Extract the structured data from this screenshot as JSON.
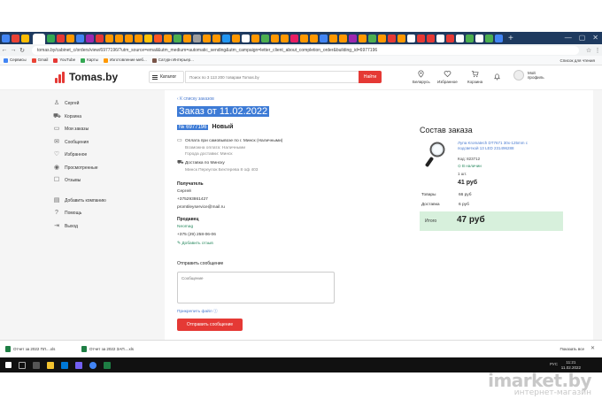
{
  "browser": {
    "url": "tomas.by/cabinet_c/orders/view/6977196/?utm_source=email&utm_medium=automatic_sending&utm_campaign=letter_client_about_completion_order&building_id=6977196",
    "bookmarks": [
      "Сервисы",
      "Gmail",
      "YouTube",
      "Карты",
      "Изготовление меб...",
      "Сатурн Интерьер..."
    ],
    "bookmarks_right": "Список для чтения"
  },
  "site": {
    "logo": "Tomas.by",
    "catalog_label": "Каталог",
    "search_placeholder": "Поиск по 3 113 200 товарам Tomas.by",
    "search_button": "Найти",
    "header_items": {
      "region": "Беларусь",
      "favorites": "Избранное",
      "cart": "Корзина",
      "profile": "Мой профиль"
    }
  },
  "sidebar": {
    "items": [
      {
        "label": "Сергей",
        "icon": "user-icon"
      },
      {
        "label": "Корзина",
        "icon": "cart-icon"
      },
      {
        "label": "Мои заказы",
        "icon": "orders-icon"
      },
      {
        "label": "Сообщения",
        "icon": "message-icon"
      },
      {
        "label": "Избранное",
        "icon": "heart-icon"
      },
      {
        "label": "Просмотренные",
        "icon": "eye-icon"
      },
      {
        "label": "Отзывы",
        "icon": "review-icon"
      }
    ],
    "items2": [
      {
        "label": "Добавить компанию",
        "icon": "add-company-icon"
      },
      {
        "label": "Помощь",
        "icon": "help-icon"
      },
      {
        "label": "Выход",
        "icon": "logout-icon"
      }
    ]
  },
  "order": {
    "back_link": "К списку заказов",
    "title": "Заказ от 11.02.2022",
    "number": "№ 6977196",
    "status": "Новый",
    "payment": {
      "title": "Оплата при самовывозе по г. Минск (Наличными)",
      "line2": "Возможна оплата: Наличными",
      "line3": "Города доставки: Минск"
    },
    "delivery": {
      "title": "Доставка по Минску",
      "address": "Минск Переулок Бехтерева 8 оф 403"
    },
    "recipient": {
      "heading": "Получатель",
      "name": "Сергей",
      "phone": "+375293861427",
      "email": "promtileyservice@mail.ru"
    },
    "seller": {
      "heading": "Продавец",
      "name": "Neomag",
      "phone": "+375 (29) 258-06-06",
      "review_link": "Добавить отзыв"
    },
    "message": {
      "heading": "Отправить сообщение",
      "placeholder": "Сообщение",
      "attach": "Прикрепить файл",
      "send_button": "Отправить сообщение"
    }
  },
  "composition": {
    "title": "Состав заказа",
    "product": {
      "name": "Лупа Kromatech DT7671 30x-125mm с подсветкой 13 LED 231496288",
      "code": "Код: 823712",
      "availability": "В наличии",
      "qty": "1 шт.",
      "price": "41 руб"
    },
    "goods_label": "Товары",
    "goods_value": "66 руб",
    "delivery_label": "Доставка",
    "delivery_value": "6 руб",
    "total_label": "Итого",
    "total_value": "47 руб"
  },
  "downloads": {
    "files": [
      "Отчет за 2022 ПЛ....xls",
      "Отчет за 2022 ЗАП....xls"
    ],
    "show_all": "Показать все"
  },
  "taskbar": {
    "lang": "РУС",
    "time": "11:21",
    "date": "11.02.2022"
  },
  "watermark": {
    "line1": "imarket.by",
    "line2": "интернет-магазин"
  }
}
